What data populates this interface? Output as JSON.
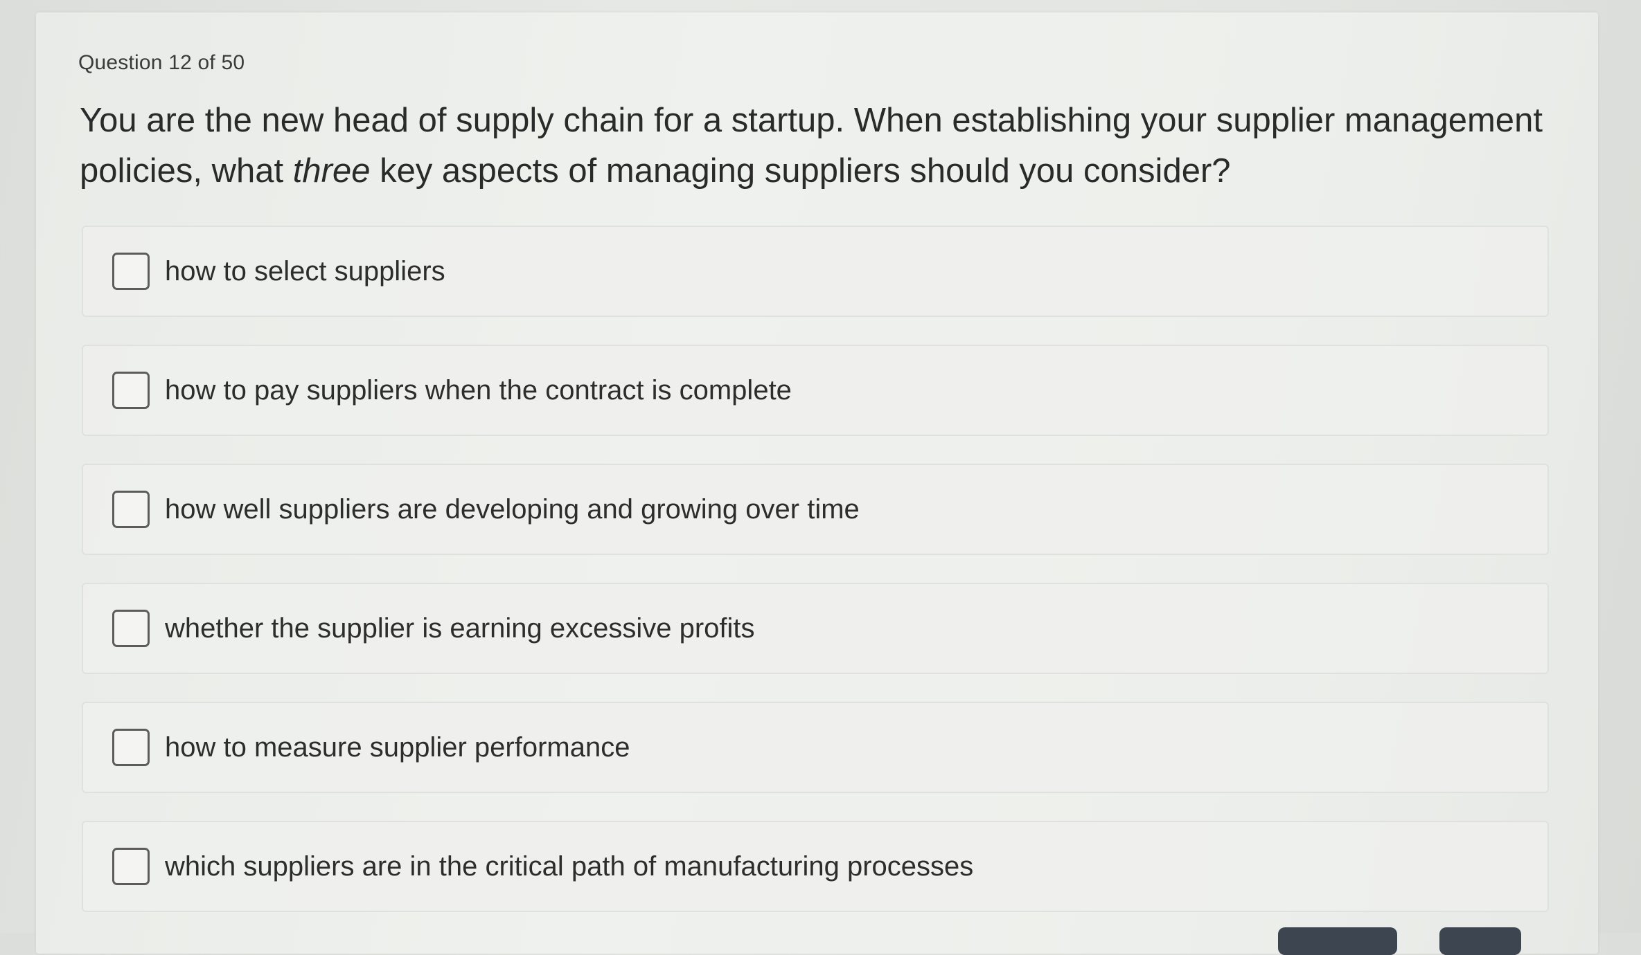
{
  "question": {
    "counter": "Question 12 of 50",
    "text_before": "You are the new head of supply chain for a startup. When establishing your supplier management policies, what ",
    "text_emphasis": "three",
    "text_after": " key aspects of managing suppliers should you consider?"
  },
  "options": [
    {
      "label": "how to select suppliers",
      "checked": false
    },
    {
      "label": "how to pay suppliers when the contract is complete",
      "checked": false
    },
    {
      "label": "how well suppliers are developing and growing over time",
      "checked": false
    },
    {
      "label": "whether the supplier is earning excessive profits",
      "checked": false
    },
    {
      "label": "how to measure supplier performance",
      "checked": false
    },
    {
      "label": "which suppliers are in the critical path of manufacturing processes",
      "checked": false
    }
  ]
}
